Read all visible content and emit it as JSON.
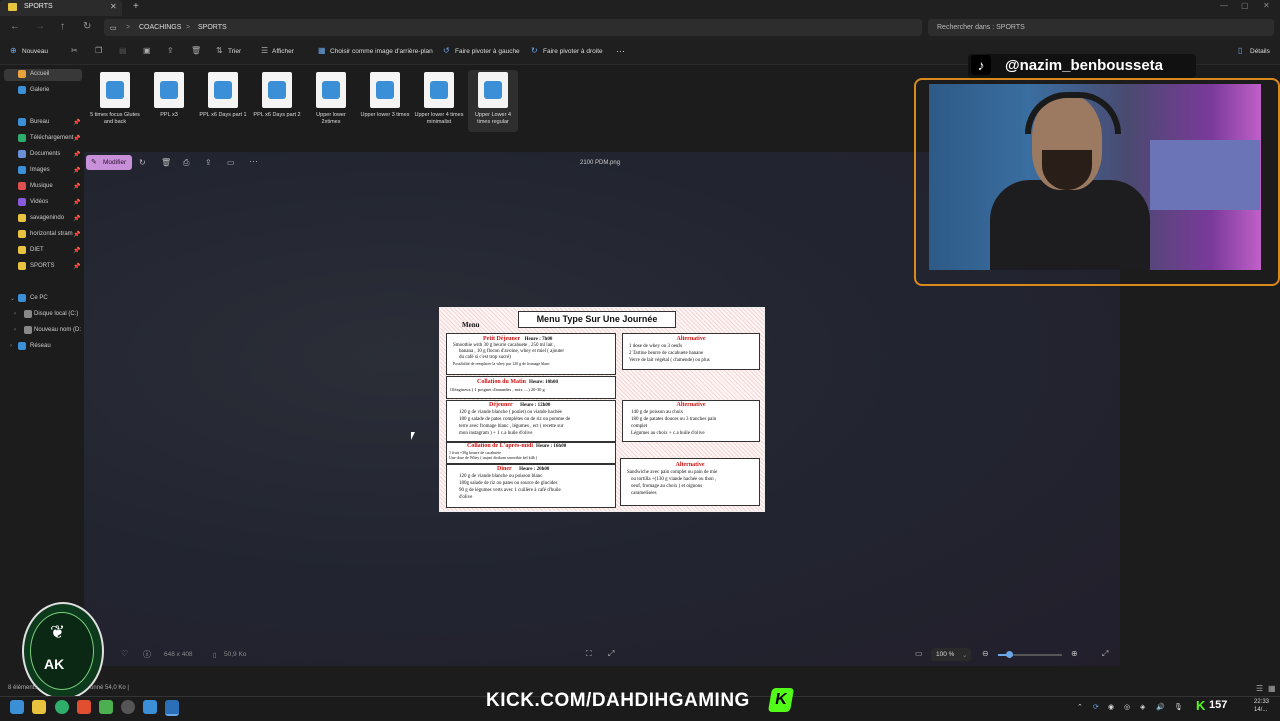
{
  "window": {
    "tab_title": "SPORTS",
    "new_tab": "+",
    "close": "✕",
    "controls": [
      "—",
      "▢",
      "✕"
    ]
  },
  "address": {
    "crumbs": [
      "COACHINGS",
      "SPORTS"
    ],
    "separator": ">",
    "search_placeholder": "Rechercher dans : SPORTS"
  },
  "command_bar": {
    "new": "Nouveau",
    "sort": "Trier",
    "view": "Afficher",
    "set_bg": "Choisir comme image d'arrière-plan",
    "rotate_left": "Faire pivoter à gauche",
    "rotate_right": "Faire pivoter à droite",
    "more": "···",
    "details": "Détails"
  },
  "sidebar": {
    "top": [
      {
        "label": "Accueil",
        "color": "#e8a33d"
      },
      {
        "label": "Galerie",
        "color": "#3b8fd6"
      }
    ],
    "pinned": [
      {
        "label": "Bureau",
        "color": "#3b8fd6"
      },
      {
        "label": "Téléchargement",
        "color": "#2fae6b"
      },
      {
        "label": "Documents",
        "color": "#6b8fd6"
      },
      {
        "label": "Images",
        "color": "#3b8fd6"
      },
      {
        "label": "Musique",
        "color": "#e05050"
      },
      {
        "label": "Vidéos",
        "color": "#8a5adc"
      },
      {
        "label": "savagenindo",
        "color": "#e8c33d"
      },
      {
        "label": "horizontal stram",
        "color": "#e8c33d"
      },
      {
        "label": "DIET",
        "color": "#e8c33d"
      },
      {
        "label": "SPORTS",
        "color": "#e8c33d"
      }
    ],
    "pc": [
      {
        "label": "Ce PC",
        "color": "#3b8fd6"
      },
      {
        "label": "Disque local (C:)",
        "color": "#888888"
      },
      {
        "label": "Nouveau nom (D:",
        "color": "#888888"
      },
      {
        "label": "Réseau",
        "color": "#3b8fd6"
      }
    ]
  },
  "files": [
    "5 times focus Glutes and back",
    "PPL x3",
    "PPL x6 Days part 1",
    "PPL x6 Days part 2",
    "Upper lower 2xtimes",
    "Upper lower 3 times",
    "Upper lower 4 times minimalist",
    "Upper Lower 4 times regular"
  ],
  "viewer": {
    "edit": "Modifier",
    "filename": "2100 PDM.png",
    "dimensions": "648 x 408",
    "size": "50,9 Ko",
    "zoom": "100 %"
  },
  "menu_image": {
    "label": "Menu",
    "title": "Menu Type Sur Une Journée",
    "breakfast_title": "Petit Déjeuner",
    "breakfast_time": "Heure : 7h00",
    "breakfast_lines": [
      "Smoothie with 30 g beurre cacahuete , 250 ml lait ,",
      "banana , 10 g flocon d'avoine, whey et miel ( ajouter",
      "du café si c'est trop sucré)",
      "Possibilité de remplacer la whey par 120 g de fromage blanc"
    ],
    "alt1_title": "Alternative",
    "alt1_lines": [
      "1 dose de whey ou 3 oeufs",
      "2 Tartine beurre de cacahuete banane",
      "Verre de lait végétal ( d'amende) ou plus"
    ],
    "snack_title": "Collation du Matin",
    "snack_time": "Heure: 10h00",
    "snack_line": "Oléagineux ( 1 poignet d'amandes , noix ....) 20-30 g",
    "lunch_title": "Déjeuner",
    "lunch_time": "Heure : 12h00",
    "lunch_lines": [
      "120 g de viande blanche ( poulet) ou viande hachée",
      "180 g salade de pates complètes ou de riz ou pomme de",
      "terre avec fromage blanc , légumes , ect ( recette sur",
      "mon instagram ) + 1 c.a huile d'olive"
    ],
    "alt2_title": "Alternative",
    "alt2_lines": [
      "140 g de poisson au choix",
      "180 g de patates douces ou 3 tranches pain",
      "complet",
      "Légumes au choix + c.a huile d'olive"
    ],
    "afternoon_title": "Collation de L'après-midi",
    "afternoon_time": "Heure : 16h00",
    "afternoon_lines": [
      "1 fruit +30g beurre de cacahuète",
      "Une dose de Whey ( tasjmi dirikom smoothie bel kilb )"
    ],
    "dinner_title": "Diner",
    "dinner_time": "Heure : 20h00",
    "dinner_lines": [
      "120 g de viande blanche ou poisson blanc",
      "180g salade de riz ou pates ou source de glucides",
      "90 g de légumes verts avec 1 cuillère à café d'huile",
      "d'olive"
    ],
    "alt3_title": "Alternative",
    "alt3_lines": [
      "Sandwiche avec pain complet ou pain de mie",
      "ou tortilla +(130 g viande hachée ou thon ,",
      "oeuf, fromage au choix ) et oignons",
      "caramelisées"
    ]
  },
  "overlay": {
    "tiktok_handle": "@nazim_benbousseta",
    "kick_url": "KICK.COM/DAHDIHGAMING",
    "kick_logo": "K",
    "logo_text": "AK"
  },
  "status": {
    "items": "8 éléments",
    "selected": "onné 54,0 Ko |"
  },
  "taskbar": {
    "viewers": "157",
    "time": "22:33",
    "date": "14/..."
  }
}
